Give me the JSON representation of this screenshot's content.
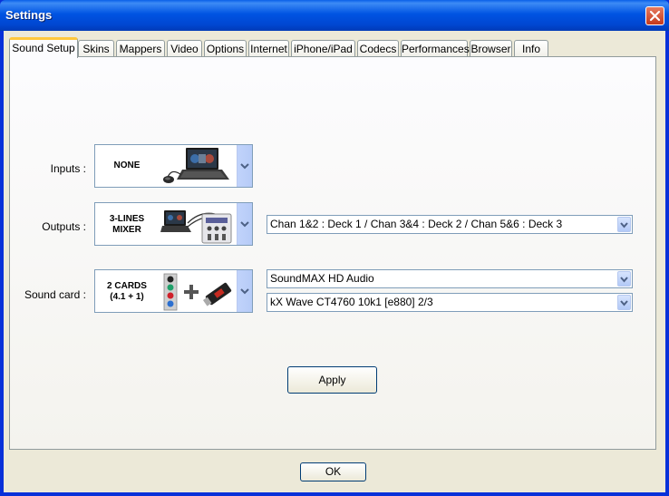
{
  "window": {
    "title": "Settings",
    "close_icon": "close-icon"
  },
  "tabs": [
    {
      "label": "Sound Setup",
      "active": true
    },
    {
      "label": "Skins"
    },
    {
      "label": "Mappers"
    },
    {
      "label": "Video"
    },
    {
      "label": "Options"
    },
    {
      "label": "Internet"
    },
    {
      "label": "iPhone/iPad"
    },
    {
      "label": "Codecs"
    },
    {
      "label": "Performances"
    },
    {
      "label": "Browser"
    },
    {
      "label": "Info"
    }
  ],
  "inputs": {
    "label": "Inputs :",
    "picker_text": "NONE",
    "picker_icon": "laptop-with-mouse-icon"
  },
  "outputs": {
    "label": "Outputs :",
    "picker_text_line1": "3-LINES",
    "picker_text_line2": "MIXER",
    "picker_icon": "laptop-with-mixer-icon",
    "channels_value": "Chan 1&2 : Deck 1 / Chan 3&4 : Deck 2 / Chan 5&6 : Deck 3"
  },
  "sound_card": {
    "label": "Sound card :",
    "picker_text_line1": "2 CARDS",
    "picker_text_line2": "(4.1 + 1)",
    "picker_icon": "audio-jacks-plus-usb-card-icon",
    "card1_value": "SoundMAX HD Audio",
    "card2_value": "kX Wave CT4760 10k1 [e880] 2/3"
  },
  "buttons": {
    "apply": "Apply",
    "ok": "OK"
  },
  "colors": {
    "titlebar": "#0054e3",
    "active_tab_accent": "#ffc83c",
    "dialog_bg": "#ece9d8",
    "close_button": "#c6391c"
  }
}
